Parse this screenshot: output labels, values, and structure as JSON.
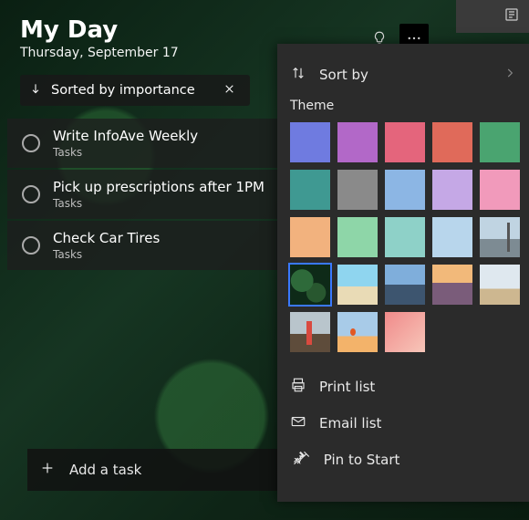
{
  "header": {
    "title": "My Day",
    "date": "Thursday, September 17"
  },
  "sortChip": {
    "label": "Sorted by importance"
  },
  "tasks": [
    {
      "title": "Write  InfoAve Weekly",
      "category": "Tasks"
    },
    {
      "title": "Pick up prescriptions after 1PM",
      "category": "Tasks"
    },
    {
      "title": "Check Car Tires",
      "category": "Tasks"
    }
  ],
  "addTask": {
    "placeholder": "Add a task"
  },
  "panel": {
    "sortBy": "Sort by",
    "themeLabel": "Theme",
    "swatches": [
      {
        "name": "blue",
        "color": "#6f7be0"
      },
      {
        "name": "purple",
        "color": "#b268c8"
      },
      {
        "name": "pink",
        "color": "#e4657c"
      },
      {
        "name": "coral",
        "color": "#e06a5a"
      },
      {
        "name": "green",
        "color": "#4aa470"
      },
      {
        "name": "teal",
        "color": "#3f9992"
      },
      {
        "name": "gray",
        "color": "#8a8a8a"
      },
      {
        "name": "sky",
        "color": "#8cb6e4"
      },
      {
        "name": "lavender",
        "color": "#c5a8e6"
      },
      {
        "name": "rose",
        "color": "#f19abb"
      },
      {
        "name": "peach",
        "color": "#f2b27e"
      },
      {
        "name": "mint",
        "color": "#8ed6a8"
      },
      {
        "name": "seafoam",
        "color": "#8ed1c8"
      },
      {
        "name": "ice",
        "color": "#b8d6ec"
      },
      {
        "name": "tower",
        "theme": "theme-tower"
      },
      {
        "name": "fern",
        "theme": "theme-fern",
        "selected": true
      },
      {
        "name": "beach",
        "theme": "theme-beach"
      },
      {
        "name": "mountain",
        "theme": "theme-mountain"
      },
      {
        "name": "sunset",
        "theme": "theme-sunset"
      },
      {
        "name": "sand",
        "theme": "theme-sand"
      },
      {
        "name": "lighthouse",
        "theme": "theme-lighthouse"
      },
      {
        "name": "balloons",
        "theme": "theme-balloons"
      },
      {
        "name": "pink-abstract",
        "theme": "theme-pinkabs"
      }
    ],
    "actions": {
      "print": "Print list",
      "email": "Email list",
      "pin": "Pin to Start"
    }
  }
}
